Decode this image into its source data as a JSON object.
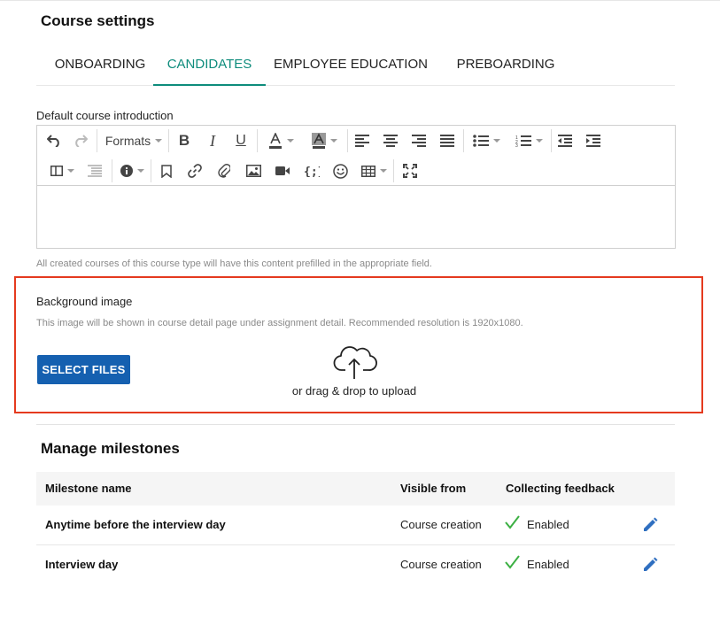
{
  "page": {
    "title": "Course settings"
  },
  "tabs": [
    {
      "label": "ONBOARDING",
      "active": false
    },
    {
      "label": "CANDIDATES",
      "active": true
    },
    {
      "label": "EMPLOYEE EDUCATION",
      "active": false
    },
    {
      "label": "PREBOARDING",
      "active": false
    }
  ],
  "intro": {
    "label": "Default course introduction",
    "formats_label": "Formats",
    "hint": "All created courses of this course type will have this content prefilled in the appropriate field.",
    "toolbar_icons": [
      "undo-icon",
      "redo-icon",
      "formats-dropdown",
      "bold-icon",
      "italic-icon",
      "underline-icon",
      "text-color-icon",
      "background-color-icon",
      "align-left-icon",
      "align-center-icon",
      "align-right-icon",
      "align-justify-icon",
      "bullet-list-icon",
      "numbered-list-icon",
      "outdent-icon",
      "indent-icon",
      "layout-icon",
      "block-list-icon",
      "info-icon",
      "bookmark-icon",
      "link-icon",
      "attachment-icon",
      "image-icon",
      "video-icon",
      "code-icon",
      "emoji-icon",
      "table-icon",
      "fullscreen-icon"
    ]
  },
  "background": {
    "title": "Background image",
    "description": "This image will be shown in course detail page under assignment detail. Recommended resolution is 1920x1080.",
    "select_label": "SELECT FILES",
    "drop_label": "or drag & drop to upload",
    "highlight_color": "#e53a1f"
  },
  "milestones": {
    "title": "Manage milestones",
    "headers": {
      "name": "Milestone name",
      "visible": "Visible from",
      "feedback": "Collecting feedback"
    },
    "rows": [
      {
        "name": "Anytime before the interview day",
        "visible": "Course creation",
        "feedback": "Enabled"
      },
      {
        "name": "Interview day",
        "visible": "Course creation",
        "feedback": "Enabled"
      }
    ]
  },
  "colors": {
    "accent": "#0e8c7c",
    "primary_button": "#1560b0",
    "check": "#3cb043",
    "edit_icon": "#2f6fc0"
  }
}
